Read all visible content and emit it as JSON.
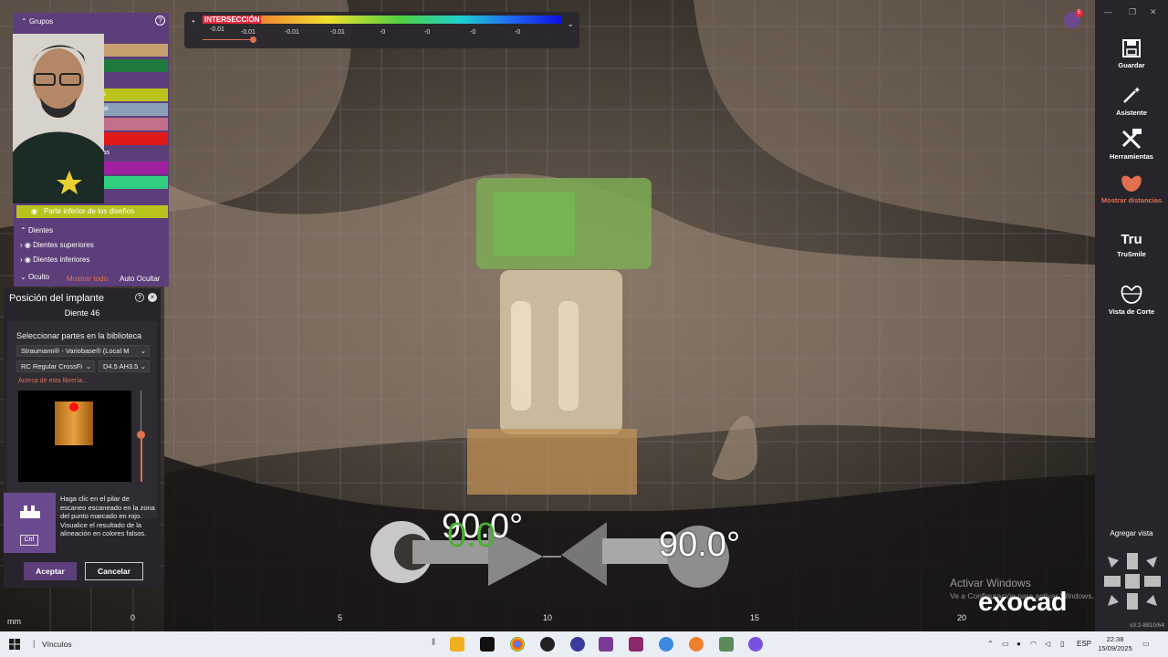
{
  "intersection": {
    "title": "INTERSECCIÓN",
    "ticks": [
      "-0.01",
      "-0.01",
      "-0.01",
      "-0.01",
      "-0",
      "-0",
      "-0",
      "-0"
    ],
    "colors": [
      "#e6283c",
      "#f0e030",
      "#50d040",
      "#2070f0"
    ]
  },
  "groups": {
    "header": "Grupos",
    "rows": [
      {
        "label": "o",
        "color": "#c8a070"
      },
      {
        "label": "o",
        "color": "#1d7a3c"
      },
      {
        "label": "",
        "color": "#5c3e7a"
      },
      {
        "label": "nillos",
        "color": "#b8c41c"
      },
      {
        "label": "virtual",
        "color": "#8aa0b8"
      },
      {
        "label": "a",
        "color": "#c07088"
      },
      {
        "label": "",
        "color": "#e01818"
      },
      {
        "label": "piezas",
        "color": "#5c3e7a"
      },
      {
        "label": "a",
        "color": "#a020a0"
      },
      {
        "label": "o",
        "color": "#30d080"
      }
    ],
    "parte_inferior": "Parte inferior de los diseños",
    "dientes_header": "Dientes",
    "dientes_superiores": "Dientes superiores",
    "dientes_inferiores": "Dientes inferiores",
    "oculto": "Oculto",
    "mostrar_todo": "Mostrar todo",
    "auto_ocultar": "Auto Ocultar"
  },
  "implant": {
    "title": "Posición del implante",
    "subtitle": "Diente 46",
    "library_label": "Seleccionar partes en la biblioteca",
    "library_select": "Straumann® - Variobase® (Local M",
    "connection_select": "RC Regular CrossFi",
    "size_select": "D4.5 AH3.5",
    "about_link": "Acerca de esta librería...",
    "hint_text": "Haga clic en el pilar de escaneo escaneado en la zona del punto marcado en rojo.",
    "hint_text2": "Visualice el resultado de la alineación en colores falsos.",
    "ctrl_key": "Ctrl",
    "accept": "Aceptar",
    "cancel": "Cancelar"
  },
  "toolbar": {
    "tools": [
      {
        "label": "Guardar",
        "icon": "save-icon"
      },
      {
        "label": "Asistente",
        "icon": "wand-icon"
      },
      {
        "label": "Herramientas",
        "icon": "tools-icon"
      },
      {
        "label": "Mostrar distancias",
        "icon": "distance-icon"
      },
      {
        "label": "TruSmile",
        "icon": "trusmile-icon"
      },
      {
        "label": "Vista de Corte",
        "icon": "section-view-icon"
      }
    ],
    "trusmile_glyph": "Tru",
    "agregar_vista": "Agregar vista",
    "version": "v3.2-8810/64",
    "notification_count": "5"
  },
  "viewport": {
    "angle_left": "90.0°",
    "angle_left_overlay": "0.0",
    "angle_right": "90.0°",
    "scale_labels": [
      "0",
      "5",
      "10",
      "15",
      "20"
    ],
    "unit": "mm",
    "watermark_line1": "Activar Windows",
    "watermark_line2": "Ve a Configuración para activar Windows.",
    "brand": "exocad"
  },
  "taskbar": {
    "link": "Vínculos",
    "lang": "ESP",
    "time": "22:38",
    "date": "15/09/2025"
  }
}
